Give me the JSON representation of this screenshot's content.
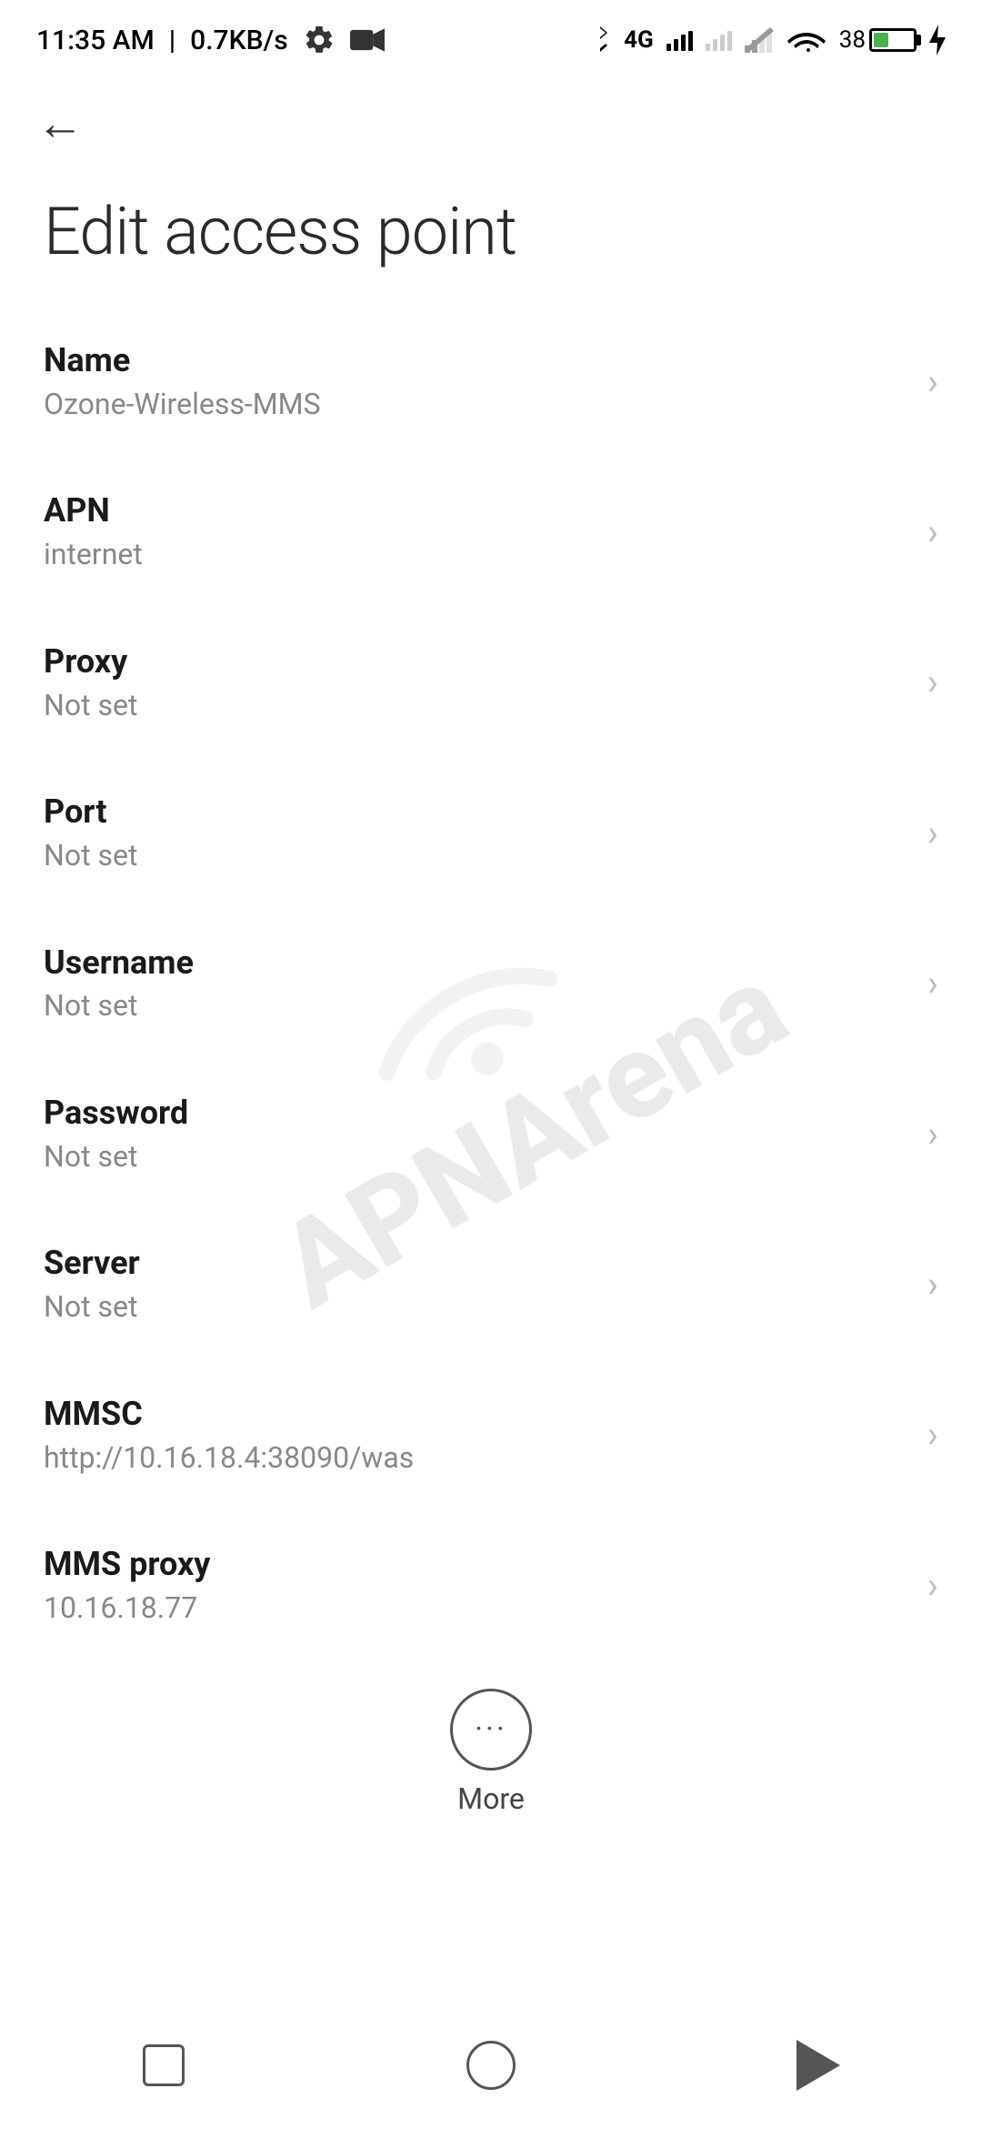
{
  "status_bar": {
    "time": "11:35 AM",
    "data_speed": "0.7KB/s",
    "battery_percent": "38"
  },
  "toolbar": {
    "back_label": "←"
  },
  "page": {
    "title": "Edit access point"
  },
  "settings_items": [
    {
      "id": "name",
      "label": "Name",
      "value": "Ozone-Wireless-MMS"
    },
    {
      "id": "apn",
      "label": "APN",
      "value": "internet"
    },
    {
      "id": "proxy",
      "label": "Proxy",
      "value": "Not set"
    },
    {
      "id": "port",
      "label": "Port",
      "value": "Not set"
    },
    {
      "id": "username",
      "label": "Username",
      "value": "Not set"
    },
    {
      "id": "password",
      "label": "Password",
      "value": "Not set"
    },
    {
      "id": "server",
      "label": "Server",
      "value": "Not set"
    },
    {
      "id": "mmsc",
      "label": "MMSC",
      "value": "http://10.16.18.4:38090/was"
    },
    {
      "id": "mms-proxy",
      "label": "MMS proxy",
      "value": "10.16.18.77"
    }
  ],
  "more_button": {
    "label": "More"
  },
  "nav": {
    "square_label": "recent",
    "circle_label": "home",
    "triangle_label": "back"
  },
  "watermark": {
    "line1": "APNArena"
  }
}
